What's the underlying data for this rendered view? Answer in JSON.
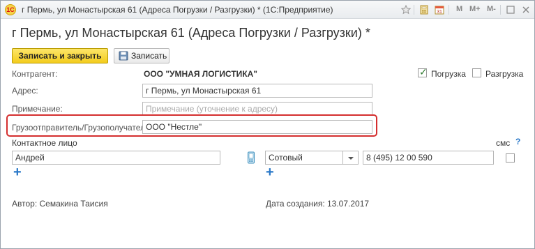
{
  "window": {
    "title": "г Пермь, ул Монастырская 61 (Адреса Погрузки / Разгрузки) *  (1С:Предприятие)",
    "toolbar_icons": [
      "star-icon",
      "calculator-icon",
      "calendar-icon"
    ],
    "memory_buttons": [
      "M",
      "M+",
      "M-"
    ],
    "window_controls": [
      "minimize-icon",
      "maximize-icon",
      "close-icon"
    ]
  },
  "header": {
    "title": "г Пермь, ул Монастырская 61 (Адреса Погрузки / Разгрузки) *"
  },
  "toolbar": {
    "save_close_label": "Записать и закрыть",
    "save_label": "Записать"
  },
  "form": {
    "counterparty_label": "Контрагент:",
    "counterparty_value": "ООО \"УМНАЯ ЛОГИСТИКА\"",
    "loading_label": "Погрузка",
    "loading_checked": true,
    "unloading_label": "Разгрузка",
    "unloading_checked": false,
    "address_label": "Адрес:",
    "address_value": "г Пермь, ул Монастырская 61",
    "note_label": "Примечание:",
    "note_placeholder": "Примечание (уточнение к адресу)",
    "shipper_label": "Грузоотправитель/Грузополучатель:",
    "shipper_value": "ООО \"Нестле\"",
    "contact_label": "Контактное лицо",
    "sms_label": "смс",
    "help_label": "?",
    "contact_name": "Андрей",
    "phone_type": "Сотовый",
    "phone_number": "8 (495) 12 00 590",
    "sms_checked": false
  },
  "footer": {
    "author": "Автор: Семакина Таисия",
    "created": "Дата создания: 13.07.2017"
  }
}
